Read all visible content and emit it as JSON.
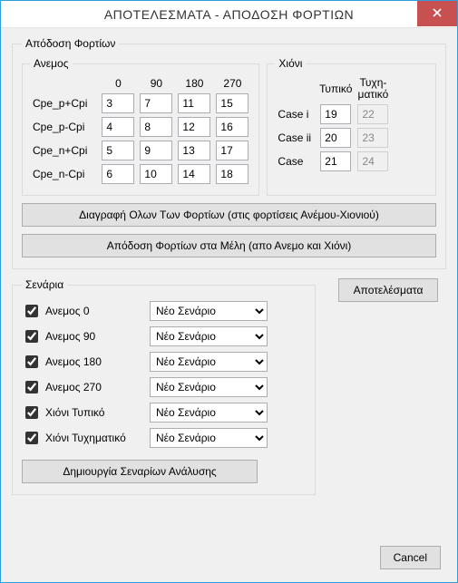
{
  "window": {
    "title": "ΑΠΟΤΕΛΕΣΜΑΤΑ - ΑΠΟΔΟΣΗ ΦΟΡΤΙΩΝ",
    "close_icon_semantic": "close-icon"
  },
  "loads": {
    "legend": "Απόδοση Φορτίων",
    "wind": {
      "legend": "Ανεμος",
      "col_headers": [
        "0",
        "90",
        "180",
        "270"
      ],
      "rows": [
        {
          "label": "Cpe_p+Cpi",
          "values": [
            "3",
            "7",
            "11",
            "15"
          ]
        },
        {
          "label": "Cpe_p-Cpi",
          "values": [
            "4",
            "8",
            "12",
            "16"
          ]
        },
        {
          "label": "Cpe_n+Cpi",
          "values": [
            "5",
            "9",
            "13",
            "17"
          ]
        },
        {
          "label": "Cpe_n-Cpi",
          "values": [
            "6",
            "10",
            "14",
            "18"
          ]
        }
      ]
    },
    "snow": {
      "legend": "Χιόνι",
      "col_headers": {
        "typical": "Τυπικό",
        "accidental_line1": "Τυχη-",
        "accidental_line2": "ματικό"
      },
      "rows": [
        {
          "label": "Case i",
          "typical": "19",
          "accidental": "22",
          "accidental_disabled": true
        },
        {
          "label": "Case ii",
          "typical": "20",
          "accidental": "23",
          "accidental_disabled": true
        },
        {
          "label": "Case",
          "typical": "21",
          "accidental": "24",
          "accidental_disabled": true
        }
      ]
    },
    "buttons": {
      "delete_all": "Διαγραφή Ολων Των Φορτίων (στις φορτίσεις Ανέμου-Χιονιού)",
      "apply_members": "Απόδοση Φορτίων στα Μέλη (απο Ανεμο και Χιόνι)"
    }
  },
  "scenarios": {
    "legend": "Σενάρια",
    "dropdown_value": "Νέο Σενάριο",
    "items": [
      {
        "label": "Ανεμος 0",
        "checked": true
      },
      {
        "label": "Ανεμος 90",
        "checked": true
      },
      {
        "label": "Ανεμος 180",
        "checked": true
      },
      {
        "label": "Ανεμος 270",
        "checked": true
      },
      {
        "label": "Χιόνι Τυπικό",
        "checked": true
      },
      {
        "label": "Χιόνι Τυχηματικό",
        "checked": true
      }
    ],
    "create_btn": "Δημιουργία Σεναρίων Ανάλυσης",
    "results_btn": "Αποτελέσματα"
  },
  "footer": {
    "cancel": "Cancel"
  }
}
